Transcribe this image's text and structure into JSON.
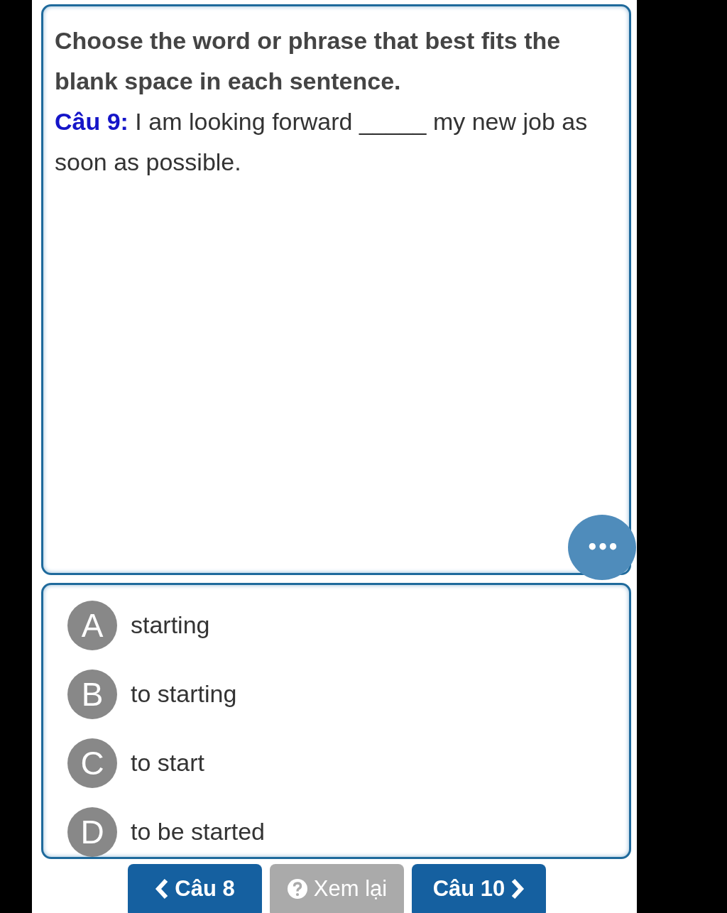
{
  "instruction": "Choose the word or phrase that best fits the blank space in each sentence.",
  "question": {
    "label": "Câu 9:",
    "text": "I am looking forward _____ my new job as soon as possible."
  },
  "more_button": {
    "label": "•••"
  },
  "options": [
    {
      "letter": "A",
      "text": "starting"
    },
    {
      "letter": "B",
      "text": "to starting"
    },
    {
      "letter": "C",
      "text": "to start"
    },
    {
      "letter": "D",
      "text": "to be started"
    }
  ],
  "nav_buttons": [
    {
      "kind": "prev",
      "label": "Câu 8",
      "disabled": false
    },
    {
      "kind": "review",
      "label": "Xem lại",
      "disabled": true
    },
    {
      "kind": "next",
      "label": "Câu 10",
      "disabled": false
    }
  ]
}
